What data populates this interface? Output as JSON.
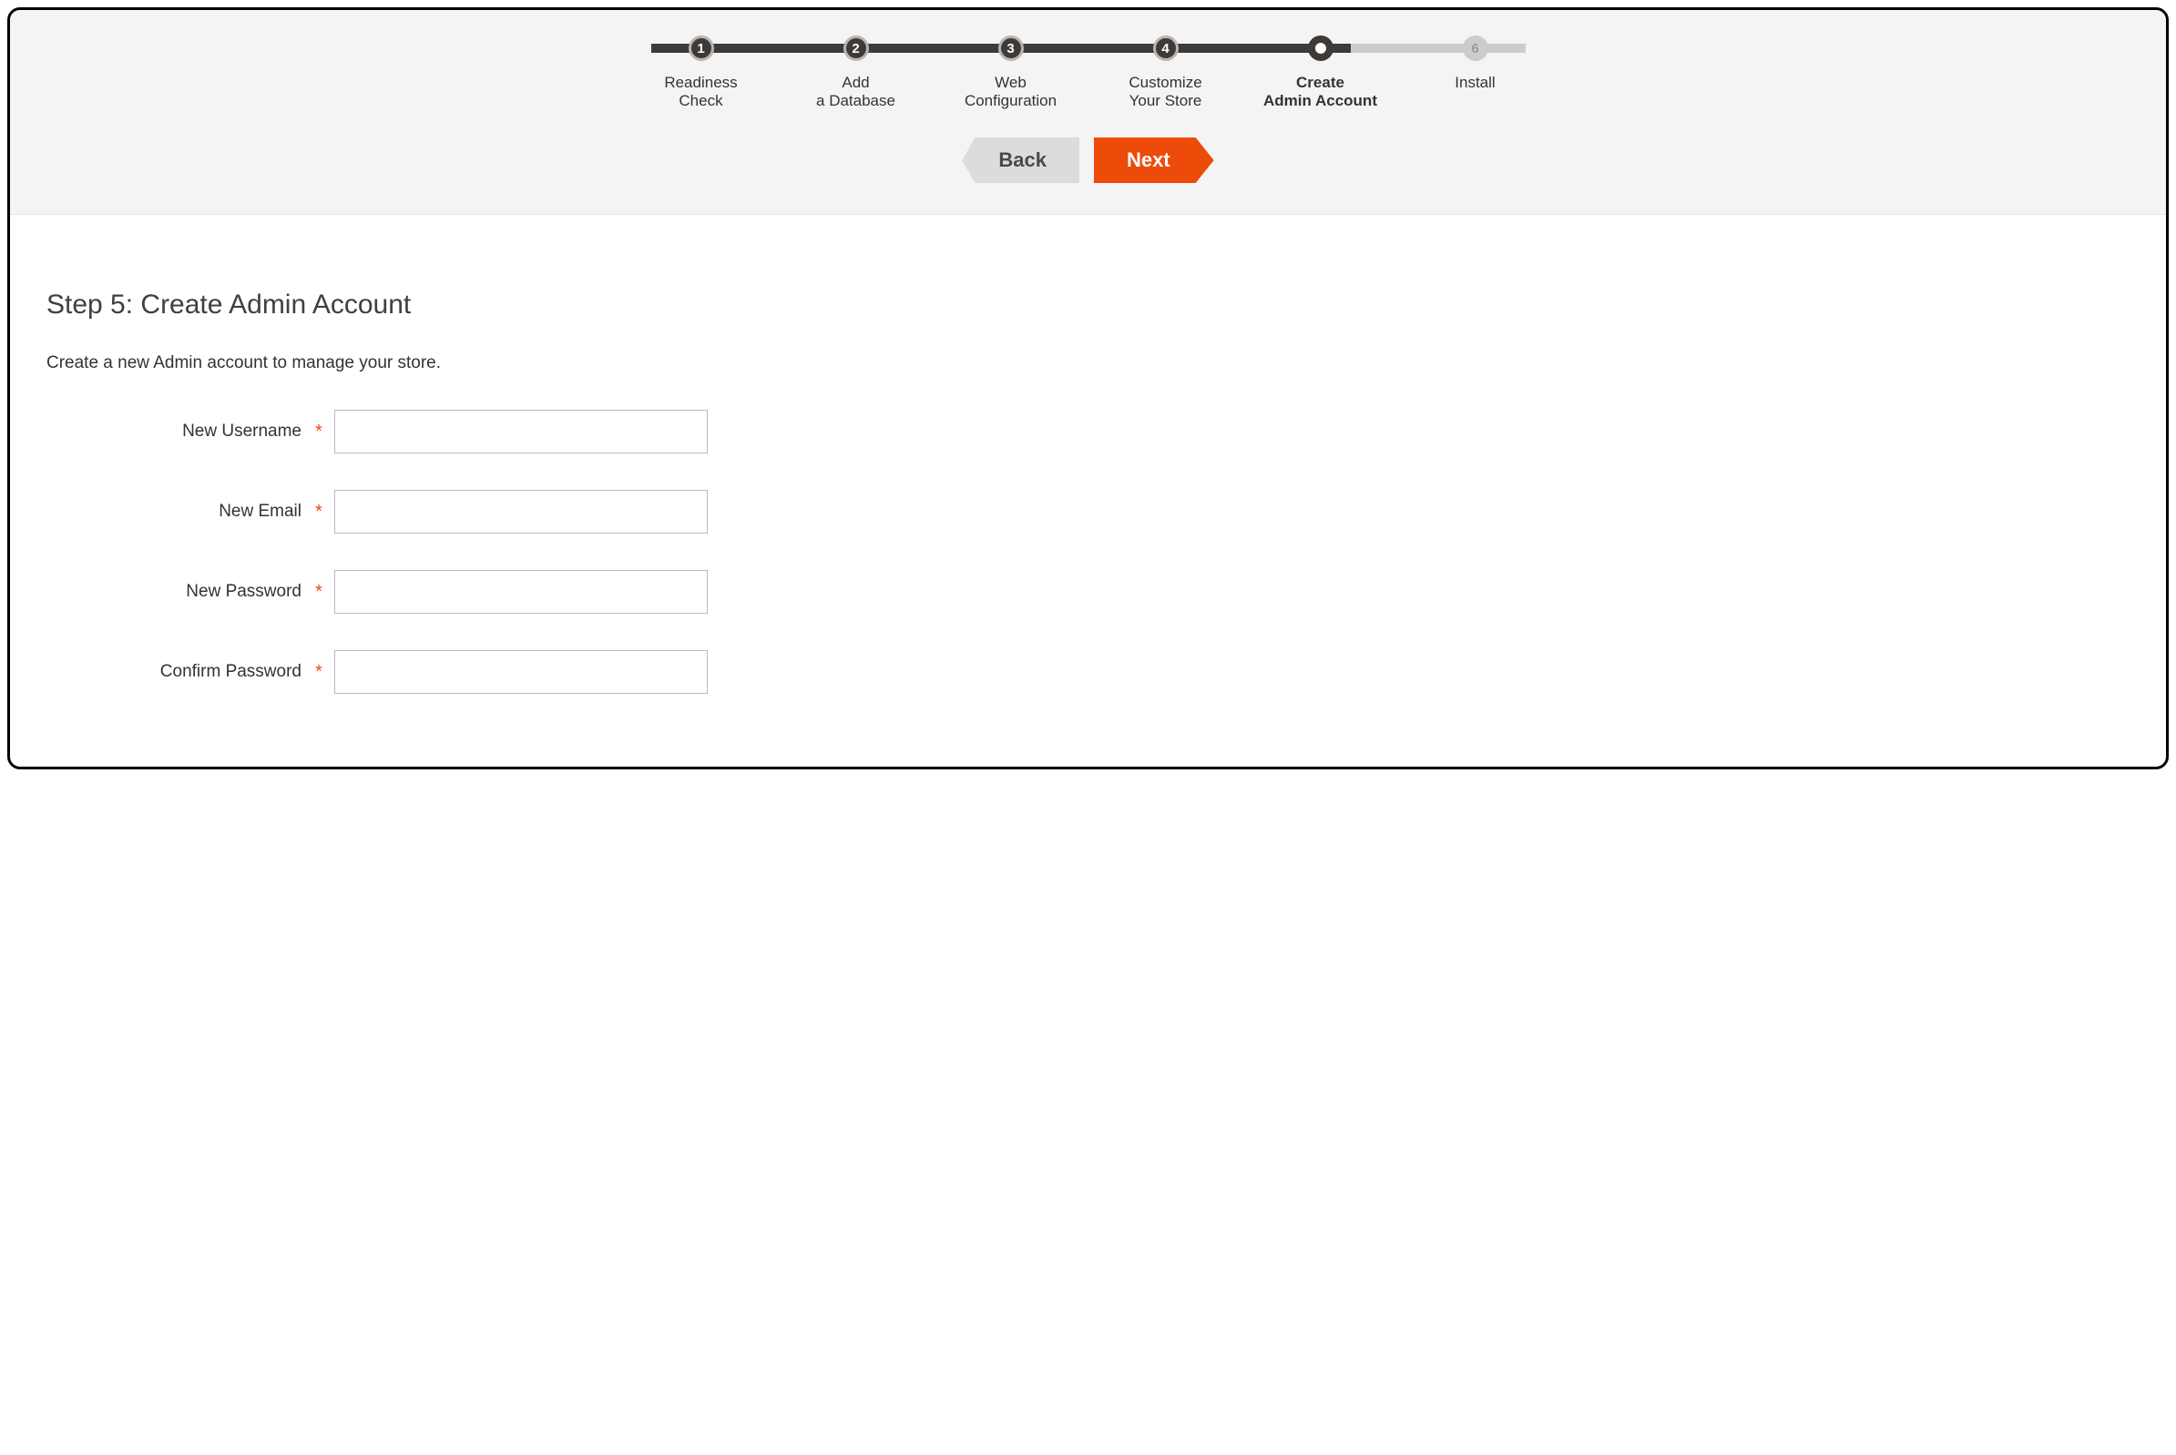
{
  "stepper": {
    "steps": [
      {
        "num": "1",
        "label": "Readiness\nCheck",
        "state": "done"
      },
      {
        "num": "2",
        "label": "Add\na Database",
        "state": "done"
      },
      {
        "num": "3",
        "label": "Web\nConfiguration",
        "state": "done"
      },
      {
        "num": "4",
        "label": "Customize\nYour Store",
        "state": "done"
      },
      {
        "num": "",
        "label": "Create\nAdmin Account",
        "state": "current"
      },
      {
        "num": "6",
        "label": "Install",
        "state": "pending"
      }
    ]
  },
  "nav": {
    "back": "Back",
    "next": "Next"
  },
  "page": {
    "title": "Step 5: Create Admin Account",
    "subtitle": "Create a new Admin account to manage your store."
  },
  "form": {
    "username_label": "New Username",
    "email_label": "New Email",
    "password_label": "New Password",
    "confirm_label": "Confirm Password",
    "username_value": "",
    "email_value": "",
    "password_value": "",
    "confirm_value": "",
    "required_mark": "*"
  }
}
